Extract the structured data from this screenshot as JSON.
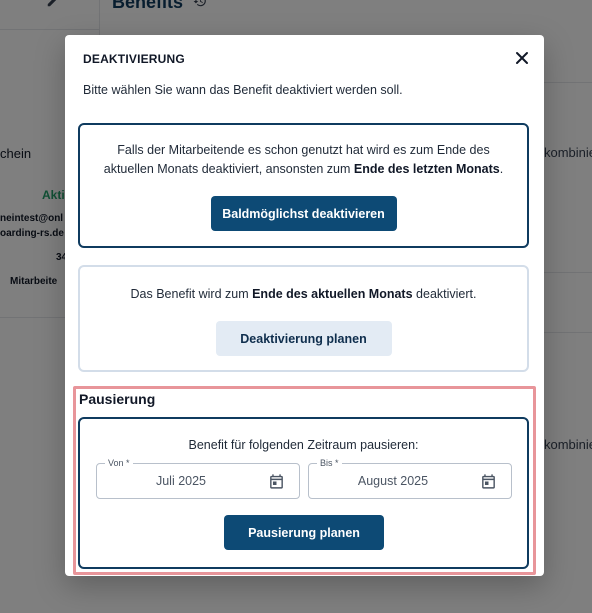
{
  "background": {
    "page_title": "Benefits",
    "left_texts": [
      "chein",
      "Akti",
      "neintest@onl",
      "oarding-rs.de",
      "34",
      "Mitarbeite"
    ],
    "right_texts": [
      "kombinie",
      "kombinie"
    ]
  },
  "modal": {
    "title": "DEAKTIVIERUNG",
    "subtitle": "Bitte wählen Sie wann das Benefit deaktiviert werden soll.",
    "option_asap": {
      "text_before": "Falls der Mitarbeitende es schon genutzt hat wird es zum Ende des aktuellen Monats deaktiviert, ansonsten zum ",
      "text_bold": "Ende des letzten Monats",
      "text_after": ".",
      "button_label": "Baldmöglichst deaktivieren"
    },
    "option_plan": {
      "text_before": "Das Benefit wird zum ",
      "text_bold": "Ende des aktuellen Monats",
      "text_after": " deaktiviert.",
      "button_label": "Deaktivierung planen"
    },
    "pause": {
      "section_title": "Pausierung",
      "description": "Benefit für folgenden Zeitraum pausieren:",
      "from_label": "Von *",
      "from_value": "Juli 2025",
      "to_label": "Bis *",
      "to_value": "August 2025",
      "button_label": "Pausierung planen"
    }
  },
  "colors": {
    "primary": "#0d4a75",
    "secondary_bg": "#e3ebf4",
    "card_border_active": "#0f3b5f",
    "card_border_inactive": "#d3dde9",
    "highlight": "#e8959a",
    "active_status": "#22a06b"
  },
  "icons": {
    "close": "close-icon",
    "calendar": "calendar-icon",
    "edit": "pencil-icon",
    "history": "history-icon"
  }
}
